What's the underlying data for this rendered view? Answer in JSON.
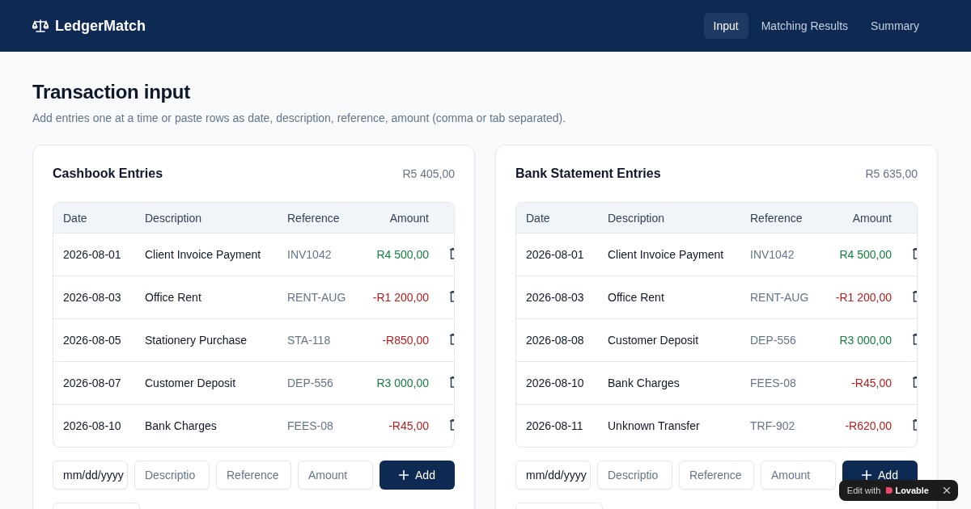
{
  "header": {
    "brand": "LedgerMatch",
    "nav": [
      {
        "label": "Input",
        "selected": true
      },
      {
        "label": "Matching Results",
        "selected": false
      },
      {
        "label": "Summary",
        "selected": false
      }
    ]
  },
  "page": {
    "title": "Transaction input",
    "subtitle": "Add entries one at a time or paste rows as date, description, reference, amount (comma or tab separated)."
  },
  "panels": [
    {
      "title": "Cashbook Entries",
      "total": "R5 405,00",
      "columns": [
        "Date",
        "Description",
        "Reference",
        "Amount"
      ],
      "rows": [
        {
          "date": "2026-08-01",
          "description": "Client Invoice Payment",
          "reference": "INV1042",
          "amount": "R4 500,00",
          "kind": "positive"
        },
        {
          "date": "2026-08-03",
          "description": "Office Rent",
          "reference": "RENT-AUG",
          "amount": "-R1 200,00",
          "kind": "negative"
        },
        {
          "date": "2026-08-05",
          "description": "Stationery Purchase",
          "reference": "STA-118",
          "amount": "-R850,00",
          "kind": "negative"
        },
        {
          "date": "2026-08-07",
          "description": "Customer Deposit",
          "reference": "DEP-556",
          "amount": "R3 000,00",
          "kind": "positive"
        },
        {
          "date": "2026-08-10",
          "description": "Bank Charges",
          "reference": "FEES-08",
          "amount": "-R45,00",
          "kind": "negative"
        }
      ],
      "form": {
        "date": "mm/dd/yyyy",
        "description_placeholder": "Descriptio",
        "reference_placeholder": "Reference",
        "amount_placeholder": "Amount",
        "button": "Add"
      }
    },
    {
      "title": "Bank Statement Entries",
      "total": "R5 635,00",
      "columns": [
        "Date",
        "Description",
        "Reference",
        "Amount"
      ],
      "rows": [
        {
          "date": "2026-08-01",
          "description": "Client Invoice Payment",
          "reference": "INV1042",
          "amount": "R4 500,00",
          "kind": "positive"
        },
        {
          "date": "2026-08-03",
          "description": "Office Rent",
          "reference": "RENT-AUG",
          "amount": "-R1 200,00",
          "kind": "negative"
        },
        {
          "date": "2026-08-08",
          "description": "Customer Deposit",
          "reference": "DEP-556",
          "amount": "R3 000,00",
          "kind": "positive"
        },
        {
          "date": "2026-08-10",
          "description": "Bank Charges",
          "reference": "FEES-08",
          "amount": "-R45,00",
          "kind": "negative"
        },
        {
          "date": "2026-08-11",
          "description": "Unknown Transfer",
          "reference": "TRF-902",
          "amount": "-R620,00",
          "kind": "negative"
        }
      ],
      "form": {
        "date": "mm/dd/yyyy",
        "description_placeholder": "Descriptio",
        "reference_placeholder": "Reference",
        "amount_placeholder": "Amount",
        "button": "Add"
      }
    }
  ],
  "badge": {
    "prefix": "Edit with",
    "brand": "Lovable"
  }
}
